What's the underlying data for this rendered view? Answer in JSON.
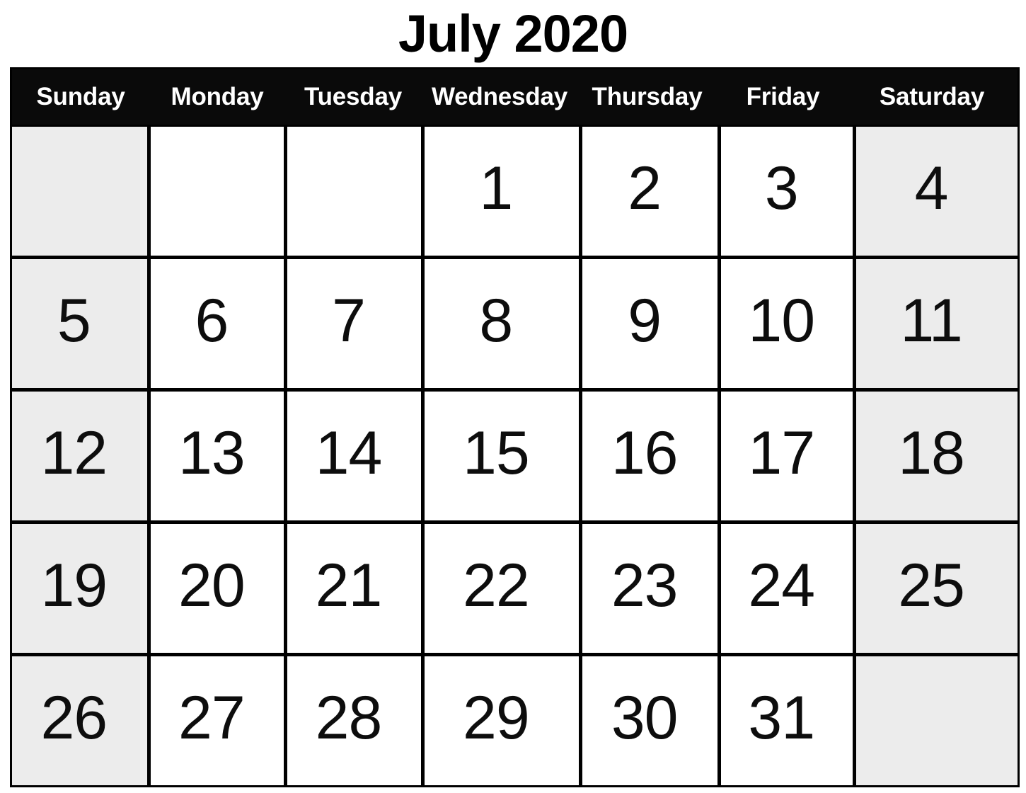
{
  "title": "July 2020",
  "month": "July",
  "year": "2020",
  "colors": {
    "header_background": "#0a0a0a",
    "header_text": "#ffffff",
    "weekend_cell": "#ececec",
    "weekday_cell": "#ffffff",
    "grid_line": "#000000",
    "day_number": "#0d0d0d"
  },
  "weekday_headers": [
    "Sunday",
    "Monday",
    "Tuesday",
    "Wednesday",
    "Thursday",
    "Friday",
    "Saturday"
  ],
  "weeks": [
    {
      "days": [
        {
          "label": "",
          "weekend": true,
          "empty": true
        },
        {
          "label": "",
          "weekend": false,
          "empty": true
        },
        {
          "label": "",
          "weekend": false,
          "empty": true
        },
        {
          "label": "1",
          "weekend": false,
          "empty": false
        },
        {
          "label": "2",
          "weekend": false,
          "empty": false
        },
        {
          "label": "3",
          "weekend": false,
          "empty": false
        },
        {
          "label": "4",
          "weekend": true,
          "empty": false
        }
      ]
    },
    {
      "days": [
        {
          "label": "5",
          "weekend": true,
          "empty": false
        },
        {
          "label": "6",
          "weekend": false,
          "empty": false
        },
        {
          "label": "7",
          "weekend": false,
          "empty": false
        },
        {
          "label": "8",
          "weekend": false,
          "empty": false
        },
        {
          "label": "9",
          "weekend": false,
          "empty": false
        },
        {
          "label": "10",
          "weekend": false,
          "empty": false
        },
        {
          "label": "11",
          "weekend": true,
          "empty": false
        }
      ]
    },
    {
      "days": [
        {
          "label": "12",
          "weekend": true,
          "empty": false
        },
        {
          "label": "13",
          "weekend": false,
          "empty": false
        },
        {
          "label": "14",
          "weekend": false,
          "empty": false
        },
        {
          "label": "15",
          "weekend": false,
          "empty": false
        },
        {
          "label": "16",
          "weekend": false,
          "empty": false
        },
        {
          "label": "17",
          "weekend": false,
          "empty": false
        },
        {
          "label": "18",
          "weekend": true,
          "empty": false
        }
      ]
    },
    {
      "days": [
        {
          "label": "19",
          "weekend": true,
          "empty": false
        },
        {
          "label": "20",
          "weekend": false,
          "empty": false
        },
        {
          "label": "21",
          "weekend": false,
          "empty": false
        },
        {
          "label": "22",
          "weekend": false,
          "empty": false
        },
        {
          "label": "23",
          "weekend": false,
          "empty": false
        },
        {
          "label": "24",
          "weekend": false,
          "empty": false
        },
        {
          "label": "25",
          "weekend": true,
          "empty": false
        }
      ]
    },
    {
      "days": [
        {
          "label": "26",
          "weekend": true,
          "empty": false
        },
        {
          "label": "27",
          "weekend": false,
          "empty": false
        },
        {
          "label": "28",
          "weekend": false,
          "empty": false
        },
        {
          "label": "29",
          "weekend": false,
          "empty": false
        },
        {
          "label": "30",
          "weekend": false,
          "empty": false
        },
        {
          "label": "31",
          "weekend": false,
          "empty": false
        },
        {
          "label": "",
          "weekend": true,
          "empty": true
        }
      ]
    }
  ]
}
